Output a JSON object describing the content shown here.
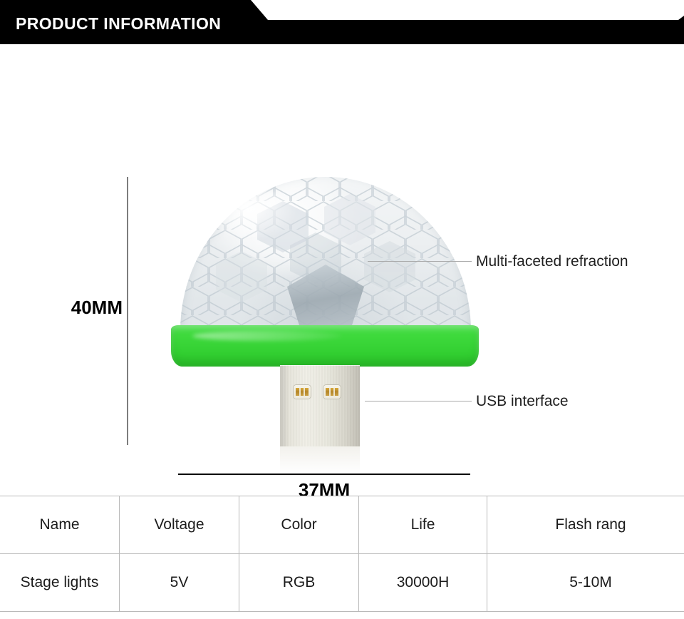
{
  "header": {
    "title": "PRODUCT INFORMATION",
    "background_color": "#000000",
    "text_color": "#ffffff"
  },
  "product": {
    "dome_label": "faceted-clear-dome",
    "base_color": "#3ED93C",
    "connector": "usb-a-male",
    "connector_color": "#E6E4DA",
    "contact_color": "#B4862A"
  },
  "dimensions": {
    "height_label": "40MM",
    "width_label": "37MM"
  },
  "callouts": [
    {
      "label": "Multi-faceted refraction"
    },
    {
      "label": "USB interface"
    }
  ],
  "spec_table": {
    "headers": [
      "Name",
      "Voltage",
      "Color",
      "Life",
      "Flash rang"
    ],
    "rows": [
      [
        "Stage lights",
        "5V",
        "RGB",
        "30000H",
        "5-10M"
      ]
    ]
  }
}
